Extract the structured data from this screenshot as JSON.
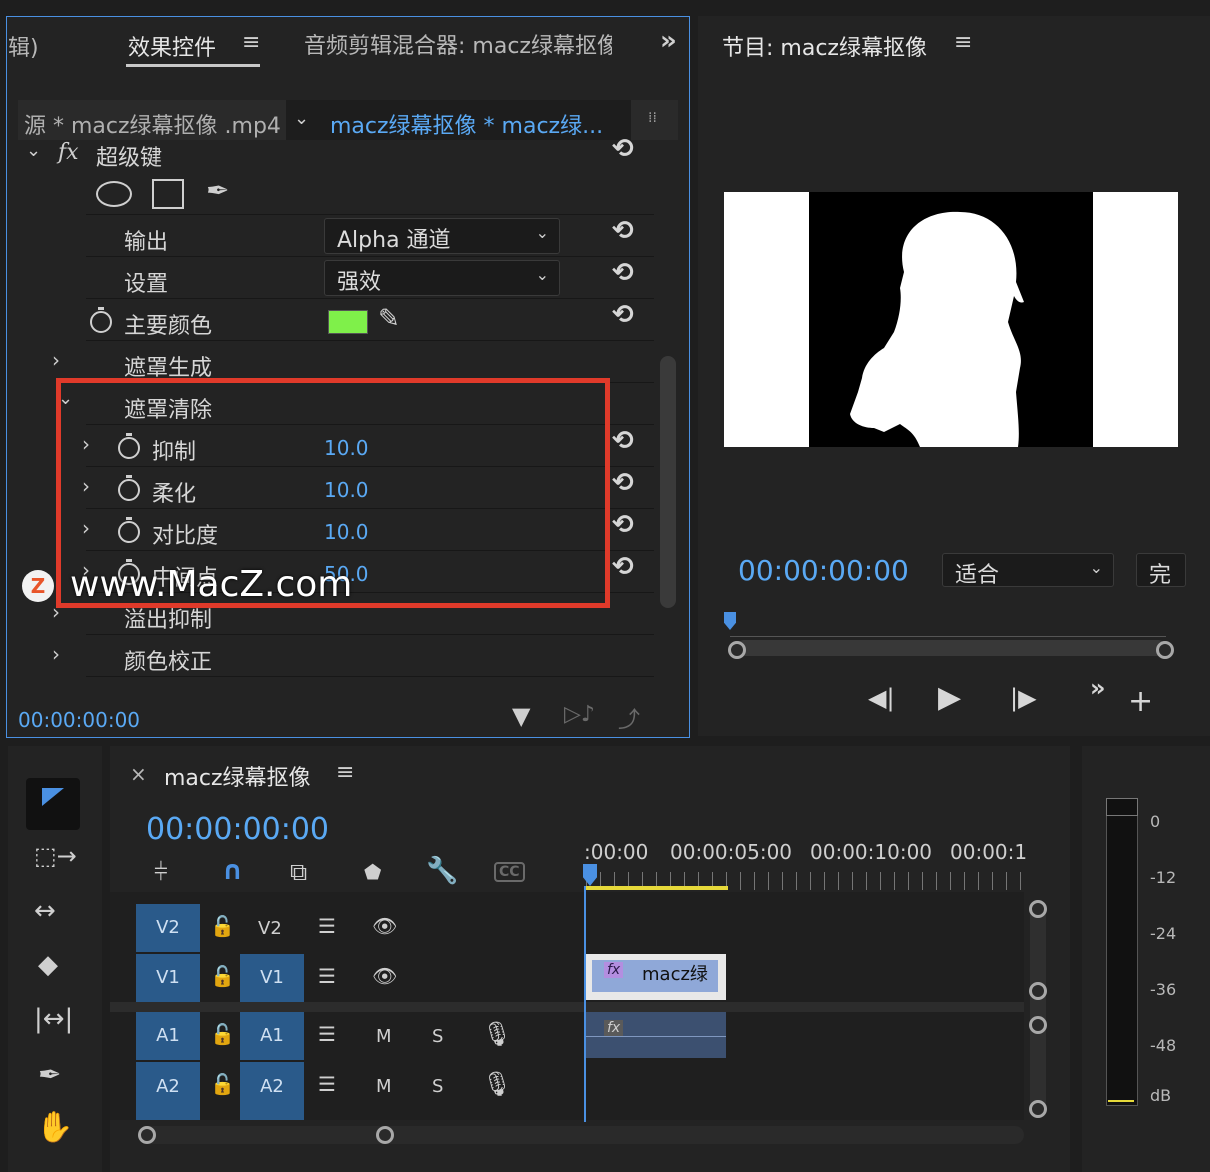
{
  "effect_controls": {
    "left_tab_fragment": "辑)",
    "tab_active": "效果控件",
    "tab_audio": "音频剪辑混合器: macz绿幕抠像",
    "source_label": "源 * macz绿幕抠像 .mp4",
    "sequence_label": "macz绿幕抠像  * macz绿...",
    "effect_name": "超级键",
    "fx_label": "fx",
    "output_label": "输出",
    "output_value": "Alpha 通道",
    "setting_label": "设置",
    "setting_value": "强效",
    "key_color_label": "主要颜色",
    "key_color": "#7ff04a",
    "matte_generation": "遮罩生成",
    "matte_cleanup": "遮罩清除",
    "params": [
      {
        "label": "抑制",
        "value": "10.0"
      },
      {
        "label": "柔化",
        "value": "10.0"
      },
      {
        "label": "对比度",
        "value": "10.0"
      },
      {
        "label": "中间点",
        "value": "50.0"
      }
    ],
    "spill_suppression": "溢出抑制",
    "color_correction": "颜色校正",
    "timecode": "00:00:00:00"
  },
  "program": {
    "title": "节目: macz绿幕抠像",
    "timecode": "00:00:00:00",
    "fit_value": "适合",
    "quality_fragment": "完"
  },
  "watermark": {
    "logo_letter": "Z",
    "text": "www.MacZ.com"
  },
  "timeline": {
    "close_glyph": "×",
    "sequence_name": "macz绿幕抠像",
    "timecode": "00:00:00:00",
    "ruler": [
      ":00:00",
      "00:00:05:00",
      "00:00:10:00",
      "00:00:1"
    ],
    "cc_label": "CC",
    "tracks": [
      {
        "src": "V2",
        "target": "V2",
        "type": "video"
      },
      {
        "src": "V1",
        "target": "V1",
        "type": "video"
      },
      {
        "src": "A1",
        "target": "A1",
        "type": "audio"
      },
      {
        "src": "A2",
        "target": "A2",
        "type": "audio"
      }
    ],
    "mute_label": "M",
    "solo_label": "S",
    "clip_label": "macz绿",
    "clip_fx": "fx"
  },
  "meter": {
    "labels": [
      "0",
      "-12",
      "-24",
      "-36",
      "-48",
      "dB"
    ]
  },
  "colors": {
    "accent_blue": "#5aa9f4",
    "highlight_box": "#e03a2a",
    "track_blue": "#2a5a8a",
    "playhead": "#4a90e2"
  }
}
